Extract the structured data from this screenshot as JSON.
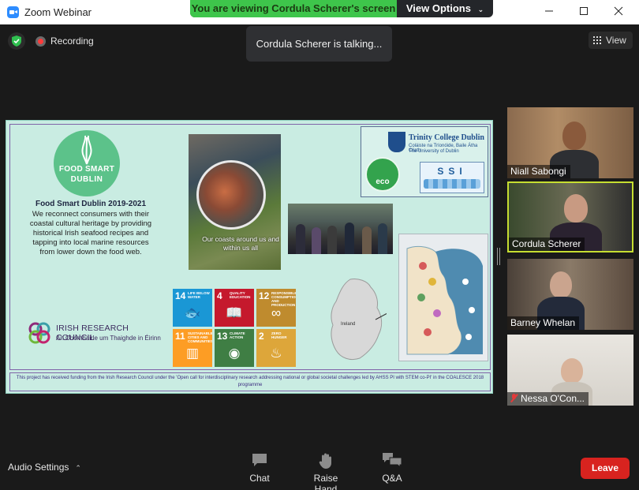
{
  "window": {
    "title": "Zoom Webinar",
    "minimize_icon": "minimize-icon",
    "maximize_icon": "maximize-icon",
    "close_icon": "close-icon"
  },
  "banner": {
    "viewing_text": "You are viewing Cordula Scherer's screen",
    "view_options_label": "View Options",
    "accent_color": "#3ec54b"
  },
  "topbar": {
    "recording_label": "Recording",
    "talking_text": "Cordula Scherer is talking...",
    "view_label": "View"
  },
  "slide": {
    "logo_line1": "FOOD SMART",
    "logo_line2": "DUBLIN",
    "title": "Food Smart Dublin 2019-2021",
    "description": "We reconnect consumers with their coastal cultural heritage by providing historical Irish seafood recipes and tapping into local marine resources from lower down the food web.",
    "photo_caption": "Our coasts around us and within us all",
    "irc_name": "IRISH RESEARCH COUNCIL",
    "irc_irish": "An Chomhairle um Thaighde in Éirinn",
    "tcd_name": "Trinity College Dublin",
    "tcd_irish": "Coláiste na Tríonóide, Baile Átha Cliath",
    "tcd_sub": "The University of Dublin",
    "eco_label": "eco",
    "ssi_label": "SSI",
    "ireland_label": "Ireland",
    "funding_text": "This project has received funding from the Irish Research Council under the 'Open call for interdisciplinary research addressing national or global societal challenges led by AHSS PI with STEM co-PI' in the COALESCE 2018 programme",
    "sdgs": [
      {
        "num": "14",
        "label": "LIFE BELOW WATER",
        "color": "#1a97d5",
        "glyph": "🐟"
      },
      {
        "num": "4",
        "label": "QUALITY EDUCATION",
        "color": "#c5192d",
        "glyph": "📖"
      },
      {
        "num": "12",
        "label": "RESPONSIBLE CONSUMPTION AND PRODUCTION",
        "color": "#bf8b2e",
        "glyph": "∞"
      },
      {
        "num": "11",
        "label": "SUSTAINABLE CITIES AND COMMUNITIES",
        "color": "#fd9d24",
        "glyph": "▥"
      },
      {
        "num": "13",
        "label": "CLIMATE ACTION",
        "color": "#3f7e44",
        "glyph": "◉"
      },
      {
        "num": "2",
        "label": "ZERO HUNGER",
        "color": "#dda63a",
        "glyph": "♨"
      }
    ]
  },
  "participants": [
    {
      "name": "Niall Sabongi",
      "muted": false,
      "active": false
    },
    {
      "name": "Cordula Scherer",
      "muted": false,
      "active": true
    },
    {
      "name": "Barney Whelan",
      "muted": false,
      "active": false
    },
    {
      "name": "Nessa O'Con...",
      "muted": true,
      "active": false
    }
  ],
  "toolbar": {
    "audio_settings_label": "Audio Settings",
    "chat_label": "Chat",
    "raise_hand_label": "Raise Hand",
    "qa_label": "Q&A",
    "leave_label": "Leave",
    "leave_color": "#d8231f"
  }
}
